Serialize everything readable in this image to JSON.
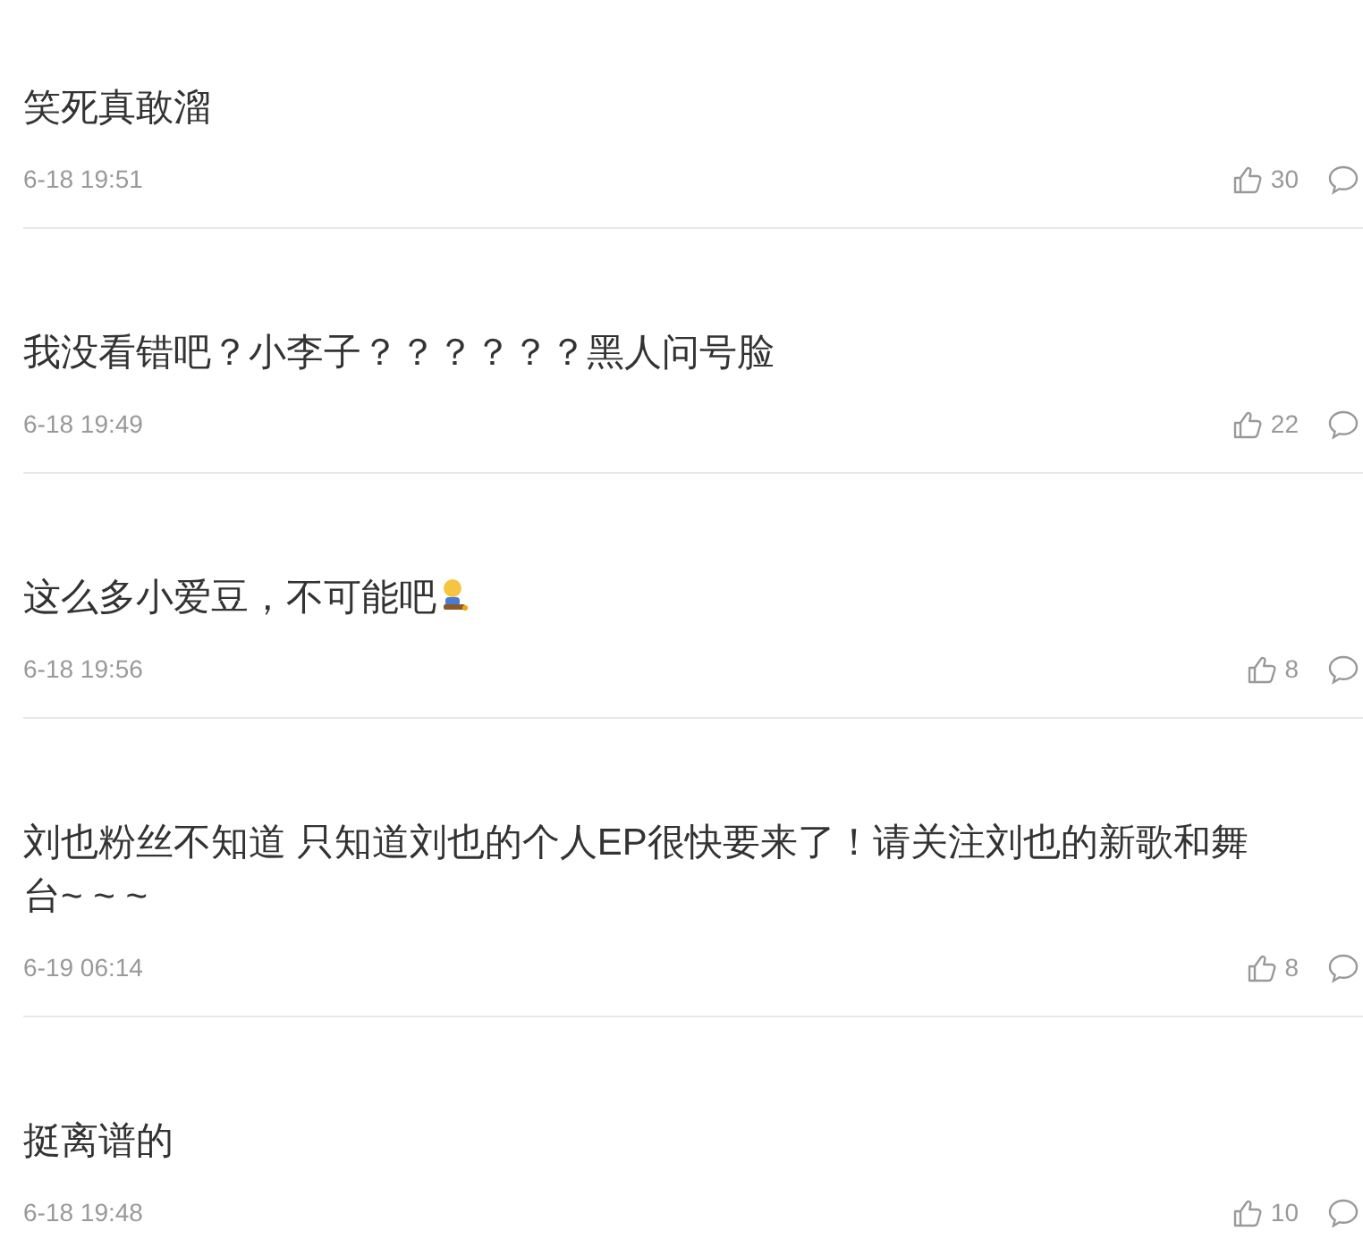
{
  "comments": [
    {
      "text": "笑死真敢溜",
      "time": "6-18 19:51",
      "likes": "30"
    },
    {
      "text": "我没看错吧？小李子？？？？？？黑人问号脸",
      "time": "6-18 19:49",
      "likes": "22"
    },
    {
      "text": "这么多小爱豆，不可能吧",
      "emoji": true,
      "time": "6-18 19:56",
      "likes": "8"
    },
    {
      "text": "刘也粉丝不知道 只知道刘也的个人EP很快要来了！请关注刘也的新歌和舞台~ ~ ~",
      "time": "6-19 06:14",
      "likes": "8"
    },
    {
      "text": "挺离谱的",
      "time": "6-18 19:48",
      "likes": "10"
    }
  ]
}
